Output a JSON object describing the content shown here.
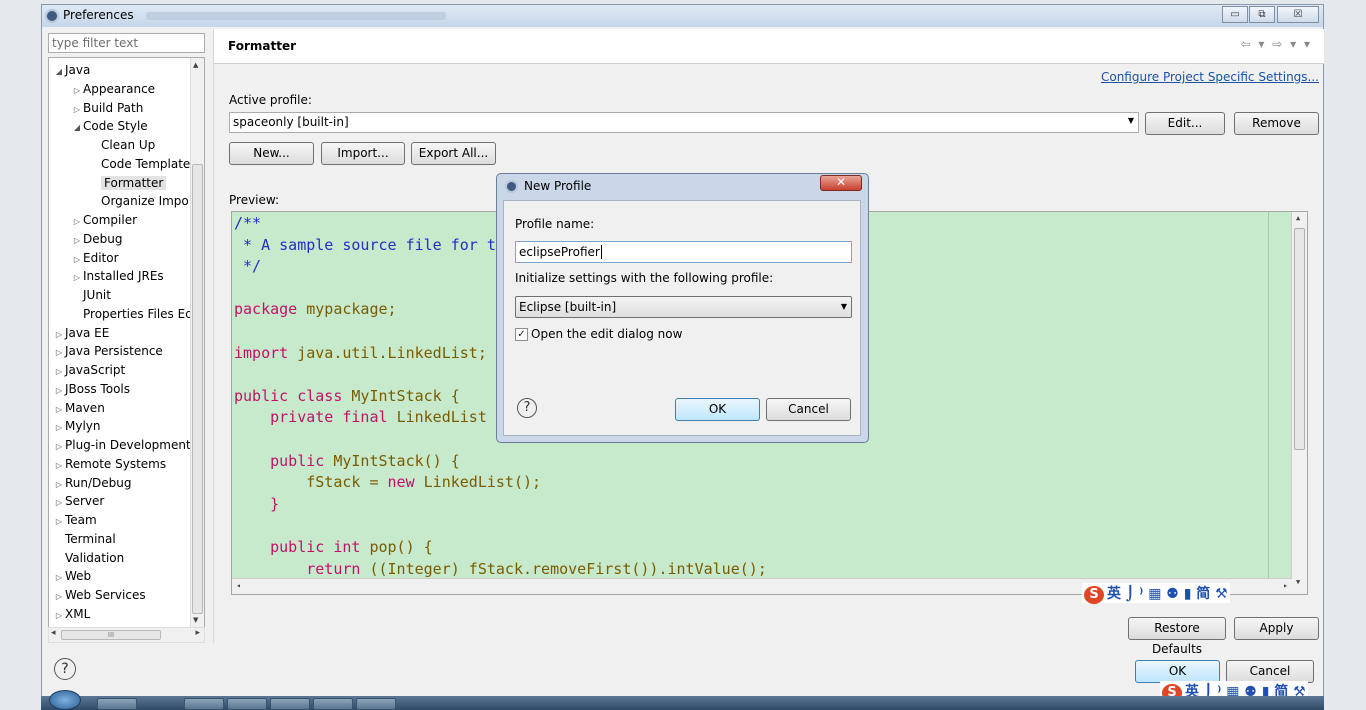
{
  "window": {
    "title": "Preferences",
    "min_glyph": "▭",
    "max_glyph": "⧉",
    "close_glyph": "☒"
  },
  "sidebar": {
    "filter_placeholder": "type filter text",
    "items": [
      {
        "label": "Java",
        "level": 0,
        "twisty": "◢"
      },
      {
        "label": "Appearance",
        "level": 1,
        "twisty": "▷"
      },
      {
        "label": "Build Path",
        "level": 1,
        "twisty": "▷"
      },
      {
        "label": "Code Style",
        "level": 1,
        "twisty": "◢"
      },
      {
        "label": "Clean Up",
        "level": 2,
        "twisty": ""
      },
      {
        "label": "Code Template",
        "level": 2,
        "twisty": ""
      },
      {
        "label": "Formatter",
        "level": 2,
        "twisty": "",
        "selected": true
      },
      {
        "label": "Organize Impo",
        "level": 2,
        "twisty": ""
      },
      {
        "label": "Compiler",
        "level": 1,
        "twisty": "▷"
      },
      {
        "label": "Debug",
        "level": 1,
        "twisty": "▷"
      },
      {
        "label": "Editor",
        "level": 1,
        "twisty": "▷"
      },
      {
        "label": "Installed JREs",
        "level": 1,
        "twisty": "▷"
      },
      {
        "label": "JUnit",
        "level": 1,
        "twisty": ""
      },
      {
        "label": "Properties Files Ed",
        "level": 1,
        "twisty": ""
      },
      {
        "label": "Java EE",
        "level": 0,
        "twisty": "▷"
      },
      {
        "label": "Java Persistence",
        "level": 0,
        "twisty": "▷"
      },
      {
        "label": "JavaScript",
        "level": 0,
        "twisty": "▷"
      },
      {
        "label": "JBoss Tools",
        "level": 0,
        "twisty": "▷"
      },
      {
        "label": "Maven",
        "level": 0,
        "twisty": "▷"
      },
      {
        "label": "Mylyn",
        "level": 0,
        "twisty": "▷"
      },
      {
        "label": "Plug-in Development",
        "level": 0,
        "twisty": "▷"
      },
      {
        "label": "Remote Systems",
        "level": 0,
        "twisty": "▷"
      },
      {
        "label": "Run/Debug",
        "level": 0,
        "twisty": "▷"
      },
      {
        "label": "Server",
        "level": 0,
        "twisty": "▷"
      },
      {
        "label": "Team",
        "level": 0,
        "twisty": "▷"
      },
      {
        "label": "Terminal",
        "level": 0,
        "twisty": ""
      },
      {
        "label": "Validation",
        "level": 0,
        "twisty": ""
      },
      {
        "label": "Web",
        "level": 0,
        "twisty": "▷"
      },
      {
        "label": "Web Services",
        "level": 0,
        "twisty": "▷"
      },
      {
        "label": "XML",
        "level": 0,
        "twisty": "▷"
      }
    ],
    "hscroll_left": "◂",
    "hscroll_mid": "III",
    "hscroll_right": "▸"
  },
  "header": {
    "title": "Formatter",
    "nav": "⇦ ▾ ⇨ ▾ ▾"
  },
  "main": {
    "configure_link": "Configure Project Specific Settings...",
    "active_profile_label": "Active profile:",
    "active_profile_value": "spaceonly [built-in]",
    "edit_button": "Edit...",
    "remove_button": "Remove",
    "new_button": "New...",
    "import_button": "Import...",
    "export_button": "Export All...",
    "preview_label": "Preview:",
    "restore_defaults_button": "Restore Defaults",
    "apply_button": "Apply"
  },
  "preview_code": [
    [
      {
        "t": "/**",
        "c": "cm"
      }
    ],
    [
      {
        "t": " * A sample source file for t",
        "c": "cm"
      }
    ],
    [
      {
        "t": " */",
        "c": "cm"
      }
    ],
    [],
    [
      {
        "t": "package ",
        "c": "kw"
      },
      {
        "t": "mypackage;",
        "c": "tx"
      }
    ],
    [],
    [
      {
        "t": "import ",
        "c": "kw"
      },
      {
        "t": "java.util.LinkedList;",
        "c": "tx"
      }
    ],
    [],
    [
      {
        "t": "public class ",
        "c": "kw"
      },
      {
        "t": "MyIntStack {",
        "c": "tx"
      }
    ],
    [
      {
        "t": "    private final ",
        "c": "kw"
      },
      {
        "t": "LinkedList",
        "c": "tx"
      }
    ],
    [],
    [
      {
        "t": "    public ",
        "c": "kw"
      },
      {
        "t": "MyIntStack() {",
        "c": "tx"
      }
    ],
    [
      {
        "t": "        fStack = ",
        "c": "tx"
      },
      {
        "t": "new ",
        "c": "kw"
      },
      {
        "t": "LinkedList();",
        "c": "tx"
      }
    ],
    [
      {
        "t": "    }",
        "c": "kw"
      }
    ],
    [],
    [
      {
        "t": "    public int ",
        "c": "kw"
      },
      {
        "t": "pop() {",
        "c": "tx"
      }
    ],
    [
      {
        "t": "        return ",
        "c": "kw"
      },
      {
        "t": "((Integer) fStack.removeFirst()).intValue();",
        "c": "tx"
      }
    ],
    [
      {
        "t": "    }",
        "c": "kw"
      }
    ]
  ],
  "dialog": {
    "title": "New Profile",
    "close_glyph": "✕",
    "profile_name_label": "Profile name:",
    "profile_name_value": "eclipseProfier",
    "init_label": "Initialize settings with the following profile:",
    "init_value": "Eclipse [built-in]",
    "open_edit_label": "Open the edit dialog now",
    "open_edit_checked": true,
    "help_glyph": "?",
    "ok_button": "OK",
    "cancel_button": "Cancel"
  },
  "footer": {
    "help_glyph": "?",
    "ok_button": "OK",
    "cancel_button": "Cancel"
  },
  "ime": {
    "logo": "S",
    "text": "英 ⌡ ⁾ ▦ ⚉ ▮ 简 ⚒"
  }
}
